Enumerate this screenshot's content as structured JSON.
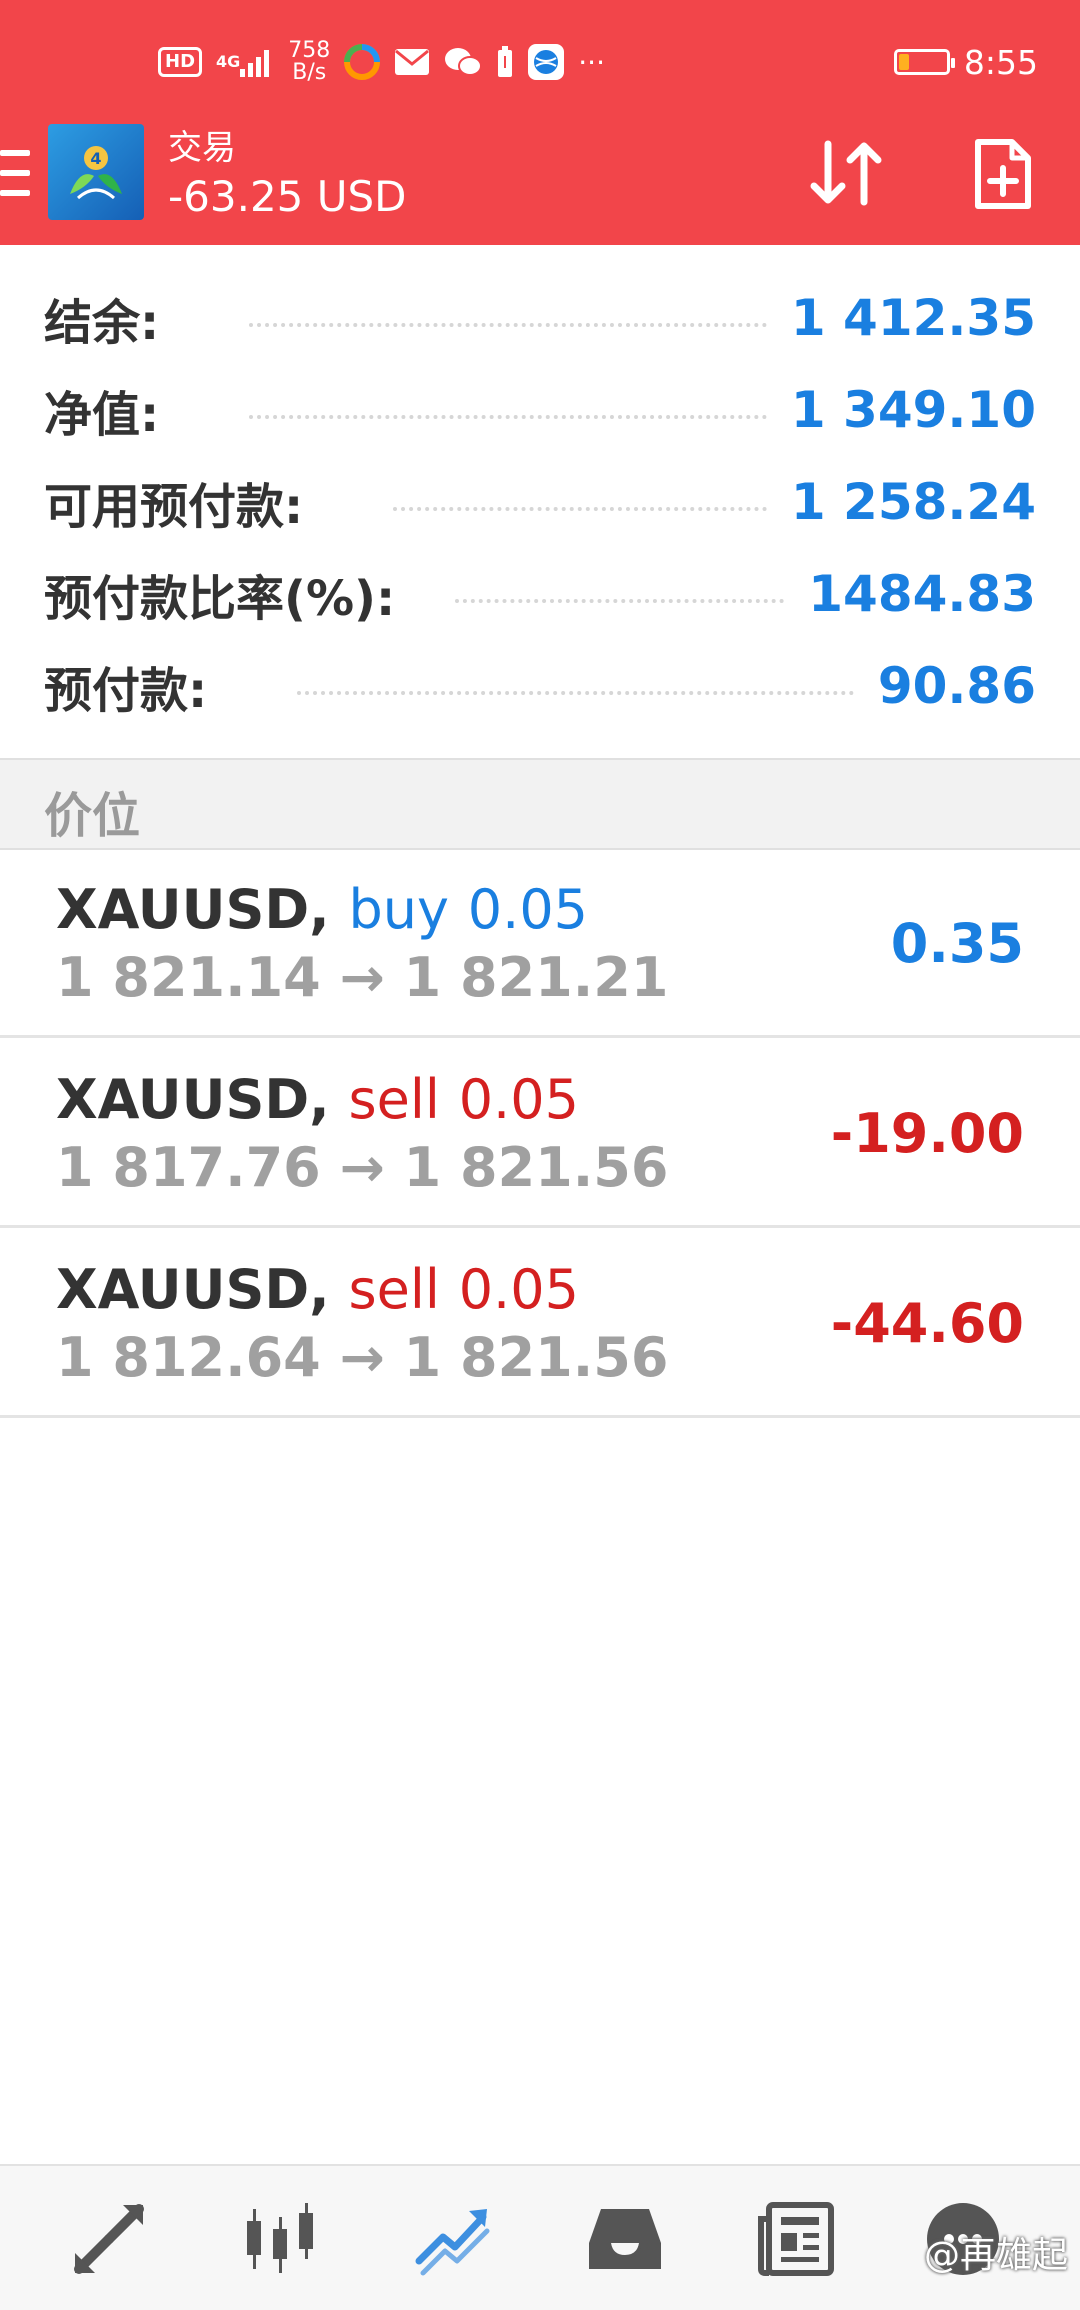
{
  "status_bar": {
    "hd": "HD",
    "signal": "4G",
    "speed_value": "758",
    "speed_unit": "B/s",
    "more": "···",
    "time": "8:55",
    "battery_level": 0.2,
    "battery_color": "#ffb020"
  },
  "header": {
    "title": "交易",
    "pnl": "-63.25 USD",
    "bg_color": "#f2454a"
  },
  "summary": [
    {
      "label": "结余:",
      "value": "1 412.35"
    },
    {
      "label": "净值:",
      "value": "1 349.10"
    },
    {
      "label": "可用预付款:",
      "value": "1 258.24"
    },
    {
      "label": "预付款比率(%):",
      "value": "1484.83"
    },
    {
      "label": "预付款:",
      "value": "90.86"
    }
  ],
  "section_title": "价位",
  "positions": [
    {
      "symbol": "XAUUSD,",
      "side": "buy",
      "volume": "0.05",
      "open_price": "1 821.14",
      "arrow": "→",
      "current_price": "1 821.21",
      "profit": "0.35"
    },
    {
      "symbol": "XAUUSD,",
      "side": "sell",
      "volume": "0.05",
      "open_price": "1 817.76",
      "arrow": "→",
      "current_price": "1 821.56",
      "profit": "-19.00"
    },
    {
      "symbol": "XAUUSD,",
      "side": "sell",
      "volume": "0.05",
      "open_price": "1 812.64",
      "arrow": "→",
      "current_price": "1 821.56",
      "profit": "-44.60"
    }
  ],
  "bottom_nav": [
    {
      "name": "quotes",
      "icon": "arrows-icon"
    },
    {
      "name": "chart",
      "icon": "candlestick-icon"
    },
    {
      "name": "trade",
      "icon": "trend-icon",
      "active": true
    },
    {
      "name": "history",
      "icon": "inbox-icon"
    },
    {
      "name": "news",
      "icon": "newspaper-icon"
    },
    {
      "name": "messages",
      "icon": "chat-icon"
    }
  ],
  "watermark": "@再雄起",
  "colors": {
    "accent_blue": "#1a7fe0",
    "loss_red": "#d42020",
    "header_red": "#f2454a"
  }
}
